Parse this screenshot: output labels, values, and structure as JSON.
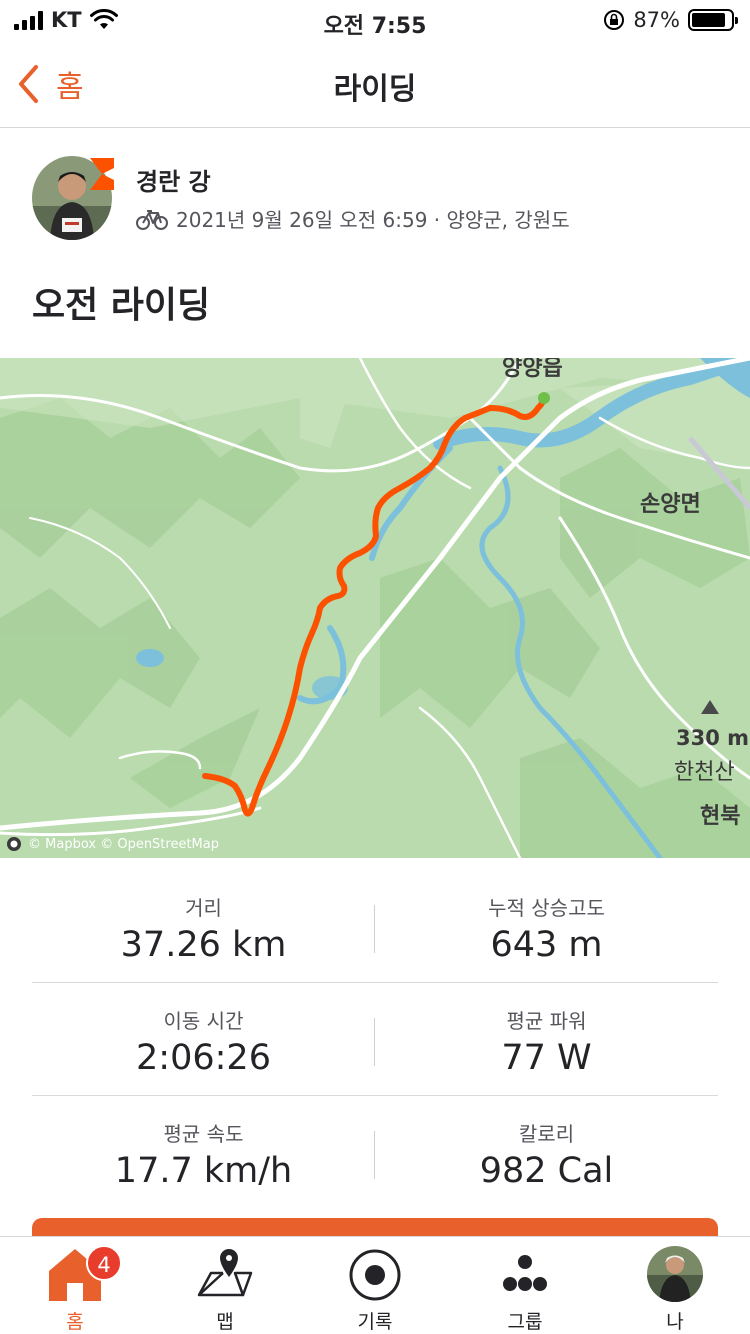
{
  "status_bar": {
    "carrier": "KT",
    "time": "오전 7:55",
    "battery": "87%",
    "battery_level": 0.87
  },
  "nav": {
    "back_label": "홈",
    "title": "라이딩"
  },
  "athlete": {
    "name": "경란 강",
    "meta": "2021년 9월 26일 오전 6:59 · 양양군, 강원도",
    "sport_icon": "bicycle-icon"
  },
  "activity": {
    "title": "오전 라이딩"
  },
  "map": {
    "labels": {
      "town_top": "양양읍",
      "town_right": "손양면",
      "peak_elevation": "330 m",
      "peak_name": "한천산",
      "place_bottom_right": "현북"
    },
    "attribution": "© Mapbox © OpenStreetMap",
    "colors": {
      "land": "#b9dbad",
      "road": "#ffffff",
      "water": "#7cc0dc",
      "route": "#fc5200"
    }
  },
  "stats": [
    {
      "label": "거리",
      "value": "37.26 km"
    },
    {
      "label": "누적 상승고도",
      "value": "643 m"
    },
    {
      "label": "이동 시간",
      "value": "2:06:26"
    },
    {
      "label": "평균 파워",
      "value": "77 W"
    },
    {
      "label": "평균 속도",
      "value": "17.7 km/h"
    },
    {
      "label": "칼로리",
      "value": "982 Cal"
    }
  ],
  "tabs": [
    {
      "label": "홈",
      "icon": "home-icon",
      "active": true,
      "badge": "4"
    },
    {
      "label": "맵",
      "icon": "map-icon",
      "active": false
    },
    {
      "label": "기록",
      "icon": "record-icon",
      "active": false
    },
    {
      "label": "그룹",
      "icon": "groups-icon",
      "active": false
    },
    {
      "label": "나",
      "icon": "profile-avatar",
      "active": false
    }
  ],
  "colors": {
    "accent": "#e8602c",
    "badge": "#e83d2c",
    "text": "#242428",
    "secondary_text": "#55555c"
  }
}
